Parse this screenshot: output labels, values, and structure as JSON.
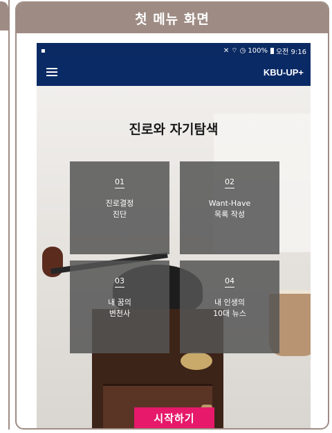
{
  "card": {
    "header_title": "첫 메뉴 화면"
  },
  "status_bar": {
    "status_text": "100%",
    "time": "오전 9:16"
  },
  "app_bar": {
    "title": "KBU-UP+"
  },
  "main": {
    "title": "진로와 자기탐색",
    "tiles": [
      {
        "number": "01",
        "label": "진로결정\n진단"
      },
      {
        "number": "02",
        "label": "Want-Have\n목록 작성"
      },
      {
        "number": "03",
        "label": "내 꿈의\n변천사"
      },
      {
        "number": "04",
        "label": "내 인생의\n10대 뉴스"
      }
    ],
    "start_button": "시작하기"
  },
  "colors": {
    "header_bg": "#9e8c84",
    "app_bar_bg": "#0a2a66",
    "start_button_bg": "#e6196b"
  }
}
